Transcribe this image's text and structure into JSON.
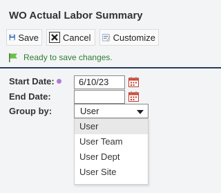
{
  "header": {
    "title": "WO Actual Labor Summary"
  },
  "toolbar": {
    "save_label": "Save",
    "cancel_label": "Cancel",
    "customize_label": "Customize"
  },
  "status": {
    "message": "Ready to save changes."
  },
  "form": {
    "start_date_label": "Start Date:",
    "start_date_value": "6/10/23",
    "end_date_label": "End Date:",
    "end_date_value": "",
    "group_by_label": "Group by:",
    "group_by_value": "User",
    "group_by_options": [
      "User",
      "User Team",
      "User Dept",
      "User Site"
    ]
  },
  "colors": {
    "divider": "#283c5a",
    "status_text": "#2e7d32",
    "required_dot": "#b07cd8"
  }
}
